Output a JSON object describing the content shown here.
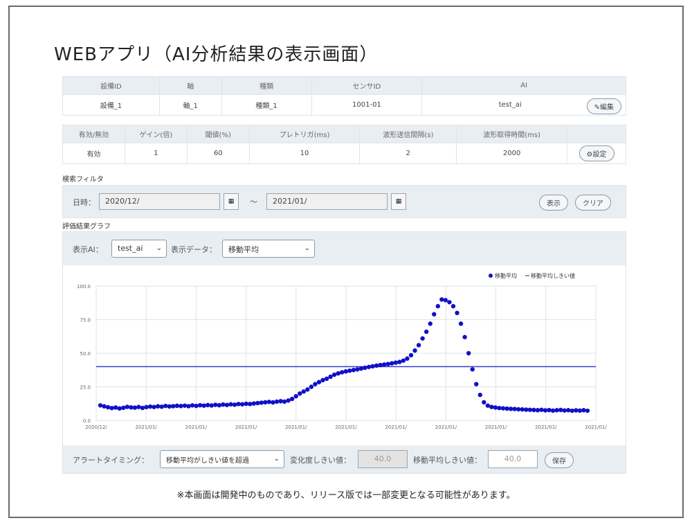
{
  "page": {
    "title": "WEBアプリ（AI分析結果の表示画面）"
  },
  "device_table": {
    "headers": [
      "設備ID",
      "軸",
      "種類",
      "センサID",
      "AI"
    ],
    "row": [
      "設備_1",
      "軸_1",
      "種類_1",
      "1001-01",
      "test_ai"
    ],
    "edit_label": "編集"
  },
  "setting_table": {
    "headers": [
      "有効/無効",
      "ゲイン(倍)",
      "閾値(%)",
      "プレトリガ(ms)",
      "波形送信間隔(s)",
      "波形取得時間(ms)"
    ],
    "row": [
      "有効",
      "1",
      "60",
      "10",
      "2",
      "2000"
    ],
    "settings_label": "設定"
  },
  "filter": {
    "section_label": "検索フィルタ",
    "date_label": "日時：",
    "from": "2020/12/",
    "separator": "～",
    "to": "2021/01/",
    "show_label": "表示",
    "clear_label": "クリア"
  },
  "graph": {
    "section_label": "評価結果グラフ",
    "ai_label": "表示AI：",
    "ai_value": "test_ai",
    "data_label": "表示データ：",
    "data_value": "移動平均"
  },
  "alert": {
    "timing_label": "アラートタイミング：",
    "timing_value": "移動平均がしきい値を超過",
    "change_label": "変化度しきい値：",
    "change_value": "40.0",
    "ma_label": "移動平均しきい値：",
    "ma_value": "40.0",
    "save_label": "保存"
  },
  "footnote": "※本画面は開発中のものであり、リリース版では一部変更となる可能性があります。",
  "chart_data": {
    "type": "scatter",
    "ylim": [
      0,
      100
    ],
    "y_ticks": [
      "0.0",
      "25.0",
      "50.0",
      "75.0",
      "100.0"
    ],
    "x_ticks": [
      "2020/12/",
      "2021/01/",
      "2021/01/",
      "2021/01/",
      "2021/01/",
      "2021/01/",
      "2021/01/",
      "2021/01/",
      "2021/01/",
      "2021/01/",
      "2021/01/"
    ],
    "legend": [
      "移動平均",
      "移動平均しきい値"
    ],
    "legend_position": "top-right",
    "grid": true,
    "colors": {
      "series": "#1010c8",
      "threshold": "#3a3ad0"
    },
    "threshold": 40,
    "series": [
      {
        "name": "移動平均",
        "values": [
          11.2,
          10.5,
          9.8,
          9.2,
          9.6,
          8.9,
          9.4,
          10.1,
          9.7,
          9.5,
          10.0,
          9.3,
          9.9,
          10.3,
          10.0,
          10.5,
          10.2,
          10.8,
          10.4,
          10.6,
          10.9,
          10.7,
          11.0,
          10.6,
          11.2,
          10.8,
          11.3,
          11.0,
          11.4,
          11.1,
          11.6,
          11.3,
          11.8,
          11.5,
          12.0,
          11.7,
          12.2,
          12.0,
          12.4,
          12.2,
          12.6,
          12.9,
          13.2,
          13.5,
          13.8,
          13.4,
          14.0,
          14.3,
          14.0,
          14.8,
          16.0,
          18.0,
          20.0,
          21.5,
          23.0,
          25.0,
          27.0,
          28.5,
          30.0,
          31.0,
          32.5,
          34.0,
          35.0,
          35.8,
          36.5,
          37.0,
          37.5,
          38.0,
          38.6,
          39.2,
          39.8,
          40.3,
          40.8,
          41.2,
          41.6,
          42.0,
          42.5,
          43.0,
          43.5,
          44.5,
          46.0,
          48.5,
          52.0,
          56.0,
          61.0,
          66.0,
          72.0,
          79.0,
          85.0,
          90.0,
          89.5,
          88.0,
          85.0,
          80.0,
          72.0,
          62.0,
          50.0,
          38.0,
          27.0,
          19.0,
          13.5,
          11.0,
          10.0,
          9.6,
          9.2,
          9.0,
          8.8,
          8.6,
          8.5,
          8.3,
          8.2,
          8.0,
          7.9,
          7.8,
          7.6,
          7.9,
          7.5,
          7.7,
          7.3,
          7.6,
          7.8,
          7.4,
          7.6,
          7.2,
          7.5,
          7.3,
          7.6,
          7.2
        ]
      }
    ]
  }
}
